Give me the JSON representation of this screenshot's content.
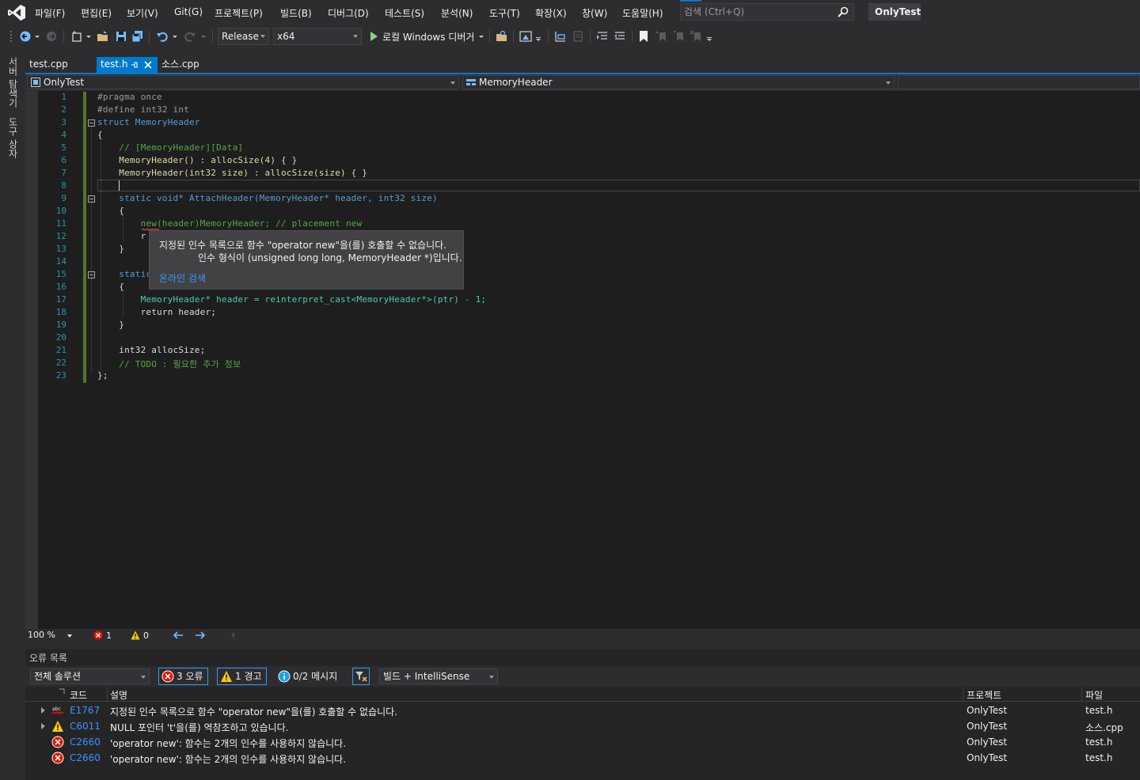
{
  "menu": {
    "items": [
      "파일(F)",
      "편집(E)",
      "보기(V)",
      "Git(G)",
      "프로젝트(P)",
      "빌드(B)",
      "디버그(D)",
      "테스트(S)",
      "분석(N)",
      "도구(T)",
      "확장(X)",
      "창(W)",
      "도움말(H)"
    ],
    "search_placeholder": "검색 (Ctrl+Q)",
    "solution_name": "OnlyTest"
  },
  "toolbar": {
    "configuration": "Release",
    "platform": "x64",
    "debugger_label": "로컬 Windows 디버거"
  },
  "side_tabs": [
    "서버 탐색기",
    "도구 상자"
  ],
  "tabs": [
    {
      "label": "test.cpp",
      "active": false
    },
    {
      "label": "test.h",
      "active": true
    },
    {
      "label": "소스.cpp",
      "active": false
    }
  ],
  "navbar": {
    "project": "OnlyTest",
    "scope": "MemoryHeader"
  },
  "editor": {
    "line_numbers": [
      "1",
      "2",
      "3",
      "4",
      "5",
      "6",
      "7",
      "8",
      "9",
      "10",
      "11",
      "12",
      "13",
      "14",
      "15",
      "16",
      "17",
      "18",
      "19",
      "20",
      "21",
      "22",
      "23"
    ],
    "lines": [
      "#pragma once",
      "#define int32 int",
      "struct MemoryHeader",
      "{",
      "    // [MemoryHeader][Data]",
      "    MemoryHeader() : allocSize(4) { }",
      "    MemoryHeader(int32 size) : allocSize(size) { }",
      "",
      "    static void* AttachHeader(MemoryHeader* header, int32 size)",
      "    {",
      "        new(header)MemoryHeader; // placement new",
      "        r",
      "    }",
      "",
      "    static",
      "    {",
      "        MemoryHeader* header = reinterpret_cast<MemoryHeader*>(ptr) - 1;",
      "        return header;",
      "    }",
      "",
      "    int32 allocSize;",
      "    // TODO : 필요한 추가 정보",
      "};"
    ]
  },
  "tooltip": {
    "message_line1": "지정된 인수 목록으로 함수 \"operator new\"을(를) 호출할 수 없습니다.",
    "message_line2": "인수 형식이 (unsigned long long, MemoryHeader *)입니다.",
    "link": "온라인 검색"
  },
  "editor_status": {
    "zoom": "100 %",
    "errors": "1",
    "warnings": "0"
  },
  "error_list": {
    "title": "오류 목록",
    "scope": "전체 솔루션",
    "errors_button": "3 오류",
    "warnings_button": "1 경고",
    "messages_button": "0/2 메시지",
    "source_filter": "빌드 + IntelliSense",
    "columns": {
      "code": "코드",
      "description": "설명",
      "project": "프로젝트",
      "file": "파일"
    },
    "rows": [
      {
        "severity": "intellisense-error",
        "code": "E1767",
        "description": "지정된 인수 목록으로 함수 \"operator new\"을(를) 호출할 수 없습니다.",
        "project": "OnlyTest",
        "file": "test.h",
        "expandable": true
      },
      {
        "severity": "warning",
        "code": "C6011",
        "description": "NULL 포인터 't'을(를) 역참조하고 있습니다.",
        "project": "OnlyTest",
        "file": "소스.cpp",
        "expandable": true
      },
      {
        "severity": "error",
        "code": "C2660",
        "description": "'operator new': 함수는 2개의 인수를 사용하지 않습니다.",
        "project": "OnlyTest",
        "file": "test.h",
        "expandable": false
      },
      {
        "severity": "error",
        "code": "C2660",
        "description": "'operator new': 함수는 2개의 인수를 사용하지 않습니다.",
        "project": "OnlyTest",
        "file": "test.h",
        "expandable": false
      }
    ]
  },
  "colors": {
    "accent": "#007acc",
    "error": "#e51400",
    "warning": "#ffcc00",
    "change_bar": "#577430"
  }
}
